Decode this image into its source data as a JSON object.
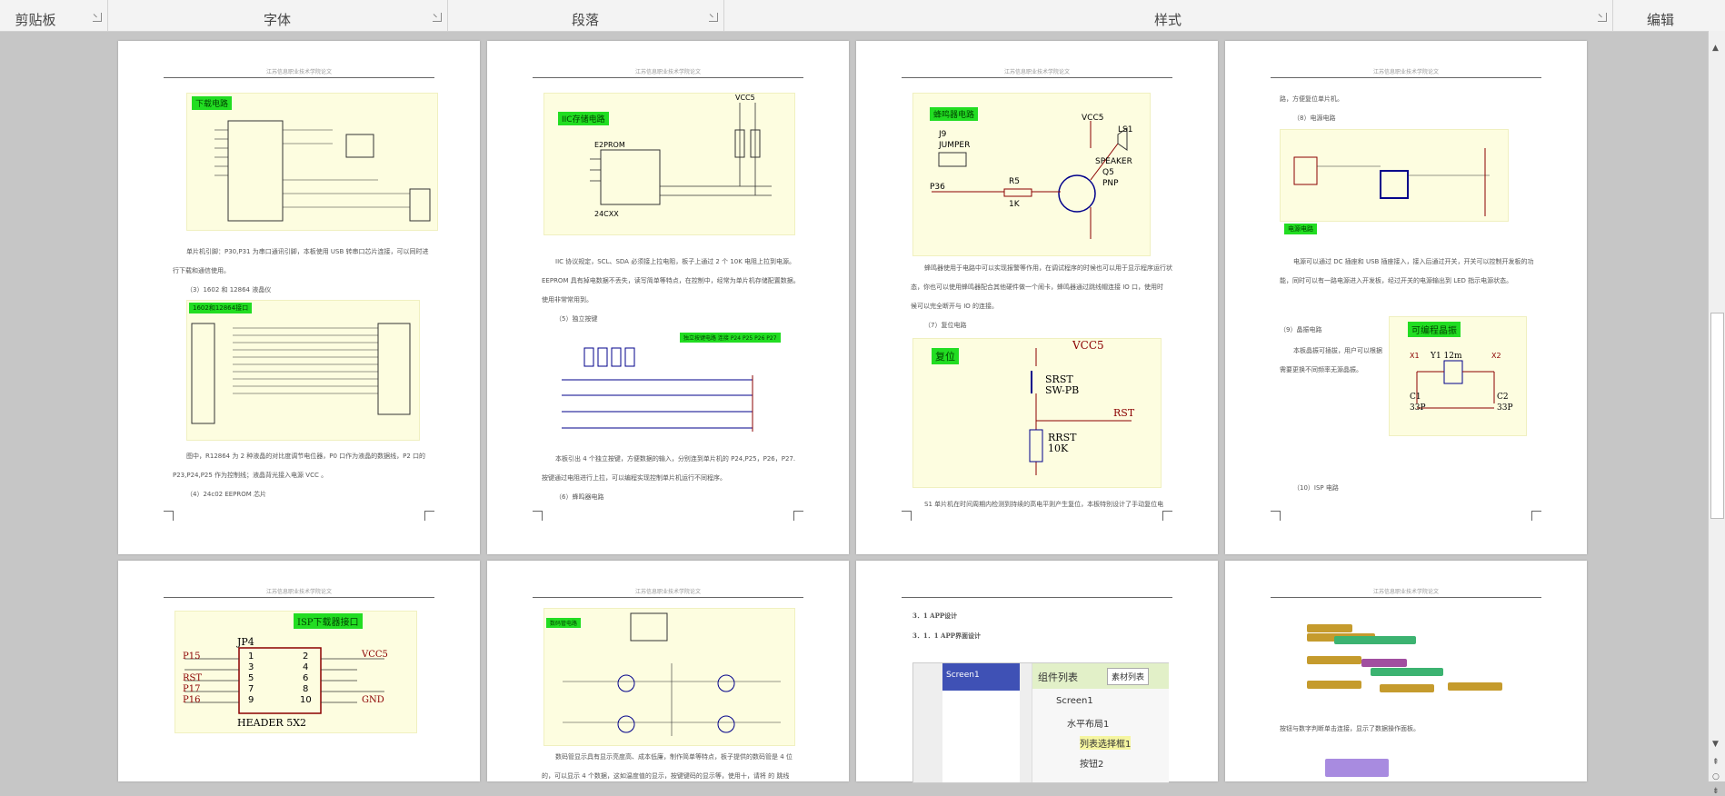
{
  "ribbon": {
    "groups": [
      {
        "label": "剪贴板"
      },
      {
        "label": "字体"
      },
      {
        "label": "段落"
      },
      {
        "label": "样式"
      },
      {
        "label": "编辑"
      }
    ]
  },
  "header_text": "江苏信息职业技术学院论文",
  "pages": {
    "p1": {
      "badge": "下载电路",
      "text1": "单片机引脚：P30,P31 为串口通讯引脚，本板使用 USB 转串口芯片连接，可以同时进",
      "text1b": "行下载和通信使用。",
      "text2": "（3）1602 和 12864 液晶仪",
      "lcd_badge": "1602和12864接口",
      "text3": "图中，R12864 为 2 种液晶的对比度调节电位器，P0 口作为液晶的数据线，P2 口的",
      "text3b": "P23,P24,P25 作为控制线；液晶背光接入电源 VCC 。",
      "text4": "（4）24c02 EEPROM 芯片"
    },
    "p2": {
      "badge": "IIC存储电路",
      "vcc": "VCC5",
      "chip": "E2PROM",
      "part": "24CXX",
      "text1": "IIC 协议规定，SCL、SDA 必须接上拉电阻，板子上通过 2 个 10K 电阻上拉到电源。",
      "text1b": "EEPROM 具有掉电数据不丢失，读写简单等特点，在控制中，经常为单片机存储配置数据。",
      "text1c": "使用非常常用到。",
      "text2": "（5）独立按键",
      "key_badge": "独立按键电路 连接 P24 P25 P26 P27",
      "text3": "本板引出 4 个独立按键，方便数据的输入，分别连到单片机的 P24,P25，P26，P27.",
      "text3b": "按键通过电阻进行上拉，可以编程实现控制单片机运行不同程序。",
      "text4": "（6）蜂鸣器电路"
    },
    "p3": {
      "badge": "蜂鸣器电路",
      "labels": [
        "J9",
        "JUMPER",
        "VCC5",
        "LS1",
        "SPEAKER",
        "Q5",
        "PNP",
        "R5",
        "1K",
        "P36"
      ],
      "text1": "蜂鸣器使用于电路中可以实现报警等作用，在调试程序的时候也可以用于显示程序运行状",
      "text1b": "态，你也可以使用蜂鸣器配合其他硬件做一个闹卡，蜂鸣器通过跳线帽连接 IO 口，使用时",
      "text1c": "候可以完全断开与 IO 的连接。",
      "text2": "（7）复位电路",
      "reset_badge": "复位",
      "reset_labels": [
        "VCC5",
        "SRST",
        "SW-PB",
        "RST",
        "RRST",
        "10K"
      ],
      "text3": "S1 单片机在时间周期内检测到持续的高电平则产生复位，本板特别设计了手动复位电"
    },
    "p4": {
      "text0": "路，方便复位单片机。",
      "text1": "（8）电源电路",
      "power_badge": "电源电路",
      "text2": "电源可以通过 DC 插座和 USB 插座接入，接入后通过开关，开关可以控制开发板的功",
      "text2b": "能，同时可以有一路电源进入开发板，经过开关的电源输出到 LED 指示电源状态。",
      "text3": "（9）晶振电路",
      "crystal_badge": "可编程晶振",
      "text4": "本板晶振可插拔，用户可以根据",
      "text4b": "需要更换不同频率无源晶振。",
      "crystal_labels": [
        "Y1 12m",
        "C1",
        "33P",
        "C2",
        "33P",
        "X1",
        "X2"
      ],
      "text5": "（10）ISP 电路"
    },
    "p5": {
      "isp_title": "ISP下载器接口",
      "jp": "JP4",
      "header": "HEADER 5X2",
      "left_pins": [
        "P15",
        "RST",
        "P17",
        "P16"
      ],
      "right_pins": [
        "VCC5",
        "GND"
      ],
      "pin_nums_left": [
        "1",
        "3",
        "5",
        "7",
        "9"
      ],
      "pin_nums_right": [
        "2",
        "4",
        "6",
        "8",
        "10"
      ]
    },
    "p6": {
      "badge": "数码管电路",
      "text1": "数码管显示具有显示亮度高、成本低廉，制作简单等特点，板子提供的数码管是 4 位",
      "text1b": "的，可以显示 4 个数据，这如温度值的显示，按键键码的显示等，使用十，请将 的 跳线"
    },
    "p7": {
      "h1": "3．1  APP设计",
      "h2": "3．1．1  APP界面设计",
      "screen": "Screen1",
      "panel_title": "组件列表",
      "panel_tab": "素材列表",
      "tree": [
        "Screen1",
        "水平布局1",
        "列表选择框1",
        "按钮2"
      ]
    },
    "p8": {
      "text1": "按钮与数字判断单击连接，显示了数据操作面板。"
    }
  }
}
